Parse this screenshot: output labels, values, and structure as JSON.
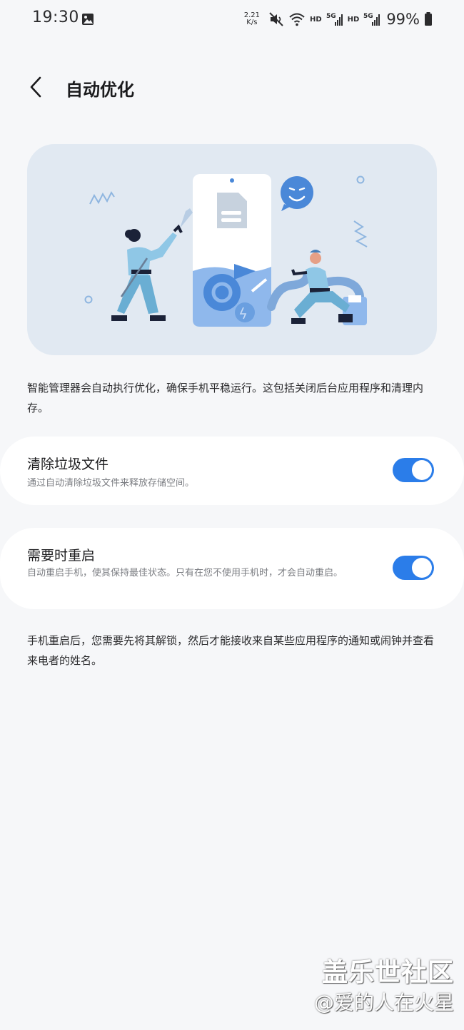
{
  "status_bar": {
    "time": "19:30",
    "net_speed_value": "2.21",
    "net_speed_unit": "K/s",
    "hd_1": "HD",
    "hd_2": "HD",
    "net_gen_1": "5G",
    "net_gen_2": "5G",
    "battery": "99%",
    "icons": [
      "gallery-icon",
      "mute-vibrate-icon",
      "wifi-icon",
      "signal-icon",
      "battery-icon"
    ]
  },
  "header": {
    "title": "自动优化",
    "back_icon": "chevron-left-icon"
  },
  "intro": "智能管理器会自动执行优化，确保手机平稳运行。这包括关闭后台应用程序和清理内存。",
  "settings": [
    {
      "title": "清除垃圾文件",
      "description": "通过自动清除垃圾文件来释放存储空间。",
      "enabled": true
    },
    {
      "title": "需要时重启",
      "description": "自动重启手机，使其保持最佳状态。只有在您不使用手机时，才会自动重启。",
      "enabled": true
    }
  ],
  "footer_note": "手机重启后，您需要先将其解锁，然后才能接收来自某些应用程序的通知或闹钟并查看来电者的姓名。",
  "watermark": {
    "brand": "盖乐世社区",
    "user": "@爱的人在火星"
  },
  "colors": {
    "background": "#f6f7f9",
    "card": "#ffffff",
    "accent": "#2b7de9",
    "illustration_bg": "#e1e9f2"
  }
}
